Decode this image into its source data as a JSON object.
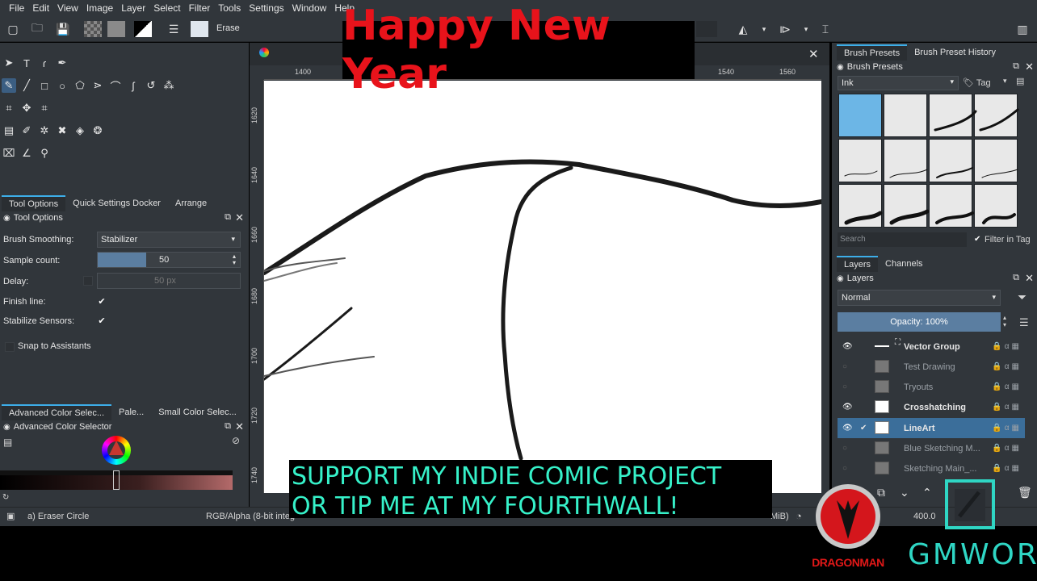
{
  "menu": [
    "File",
    "Edit",
    "View",
    "Image",
    "Layer",
    "Select",
    "Filter",
    "Tools",
    "Settings",
    "Window",
    "Help"
  ],
  "toolbar": {
    "erase_label": "Erase"
  },
  "overlay": {
    "banner": "Happy New Year",
    "support_line1": "SUPPORT MY INDIE COMIC PROJECT",
    "support_line2": "OR TIP ME AT MY FOURTHWALL!",
    "logo_left": "DRAGONMAN",
    "logo_right": "GMWOR"
  },
  "left_dock": {
    "tabs": [
      "Tool Options",
      "Quick Settings Docker",
      "Arrange"
    ],
    "title": "Tool Options",
    "brush_smoothing_label": "Brush Smoothing:",
    "brush_smoothing_value": "Stabilizer",
    "sample_count_label": "Sample count:",
    "sample_count_value": "50",
    "delay_label": "Delay:",
    "delay_value": "50 px",
    "finish_line_label": "Finish line:",
    "stabilize_label": "Stabilize Sensors:",
    "snap_label": "Snap to Assistants",
    "color_tabs": [
      "Advanced Color Selec...",
      "Pale...",
      "Small Color Selec..."
    ],
    "color_title": "Advanced Color Selector"
  },
  "rulers": {
    "h": [
      "1400",
      "1540",
      "1560"
    ],
    "v": [
      "1620",
      "1640",
      "1660",
      "1680",
      "1700",
      "1720",
      "1740"
    ]
  },
  "right_dock": {
    "tabs": [
      "Brush Presets",
      "Brush Preset History"
    ],
    "presets_title": "Brush Presets",
    "tag_value": "Ink",
    "tag_label": "Tag",
    "search_placeholder": "Search",
    "filter_label": "Filter in Tag",
    "layer_tabs": [
      "Layers",
      "Channels"
    ],
    "layers_title": "Layers",
    "blend_mode": "Normal",
    "opacity": "Opacity:  100%",
    "layers": [
      {
        "name": "Vector Group",
        "visible": true,
        "selected": false
      },
      {
        "name": "Test Drawing",
        "visible": false,
        "selected": false
      },
      {
        "name": "Tryouts",
        "visible": false,
        "selected": false
      },
      {
        "name": "Crosshatching",
        "visible": true,
        "selected": false
      },
      {
        "name": "LineArt",
        "visible": true,
        "selected": true
      },
      {
        "name": "Blue Sketching M...",
        "visible": false,
        "selected": false
      },
      {
        "name": "Sketching Main_...",
        "visible": false,
        "selected": false
      }
    ]
  },
  "status": {
    "tool": "a) Eraser Circle",
    "color_space": "RGB/Alpha (8-bit integ",
    "memory": "MiB)",
    "zoom": "400.0"
  }
}
